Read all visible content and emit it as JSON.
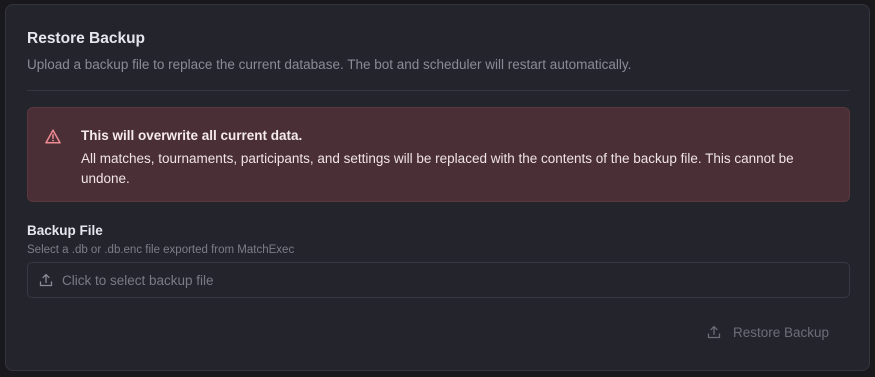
{
  "card": {
    "title": "Restore Backup",
    "subtitle": "Upload a backup file to replace the current database. The bot and scheduler will restart automatically."
  },
  "alert": {
    "icon": "warning-triangle-icon",
    "heading": "This will overwrite all current data.",
    "body": "All matches, tournaments, participants, and settings will be replaced with the contents of the backup file. This cannot be undone."
  },
  "backup_field": {
    "label": "Backup File",
    "hint": "Select a .db or .db.enc file exported from MatchExec",
    "placeholder": "Click to select backup file",
    "icon": "upload-icon"
  },
  "restore_button": {
    "label": "Restore Backup",
    "icon": "upload-icon",
    "disabled": true
  },
  "colors": {
    "card_bg": "#24242d",
    "alert_bg": "#4a3036",
    "alert_icon": "#f08a92",
    "muted_text": "#8b8b96"
  }
}
